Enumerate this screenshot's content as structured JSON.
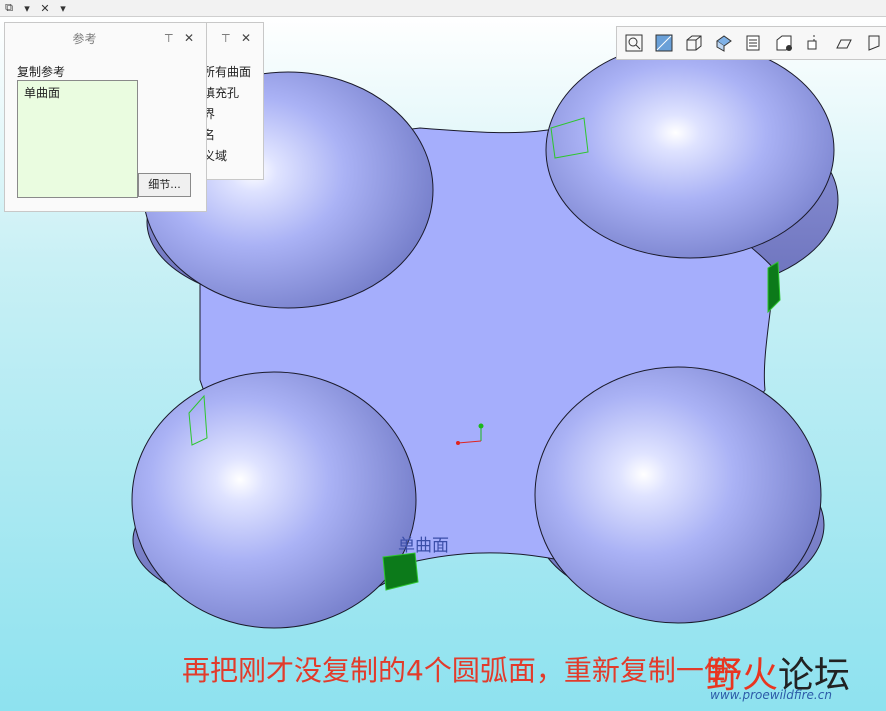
{
  "topbar": {
    "icons": [
      "window-restore-icon",
      "dropdown-arrow-icon",
      "tools-icon",
      "dropdown-arrow-icon"
    ]
  },
  "ref_panel": {
    "title": "参考",
    "section_label": "复制参考",
    "items": [
      "单曲面"
    ],
    "details_button": "细节..."
  },
  "back_panel": {
    "items": [
      "所有曲面",
      "填充孔",
      "界",
      "名",
      "义域"
    ]
  },
  "view_toolbar": {
    "icons": [
      "zoom-fit-icon",
      "zoom-area-icon",
      "display-style-icon",
      "saved-views-icon",
      "layers-icon",
      "camera-icon",
      "spin-center-icon",
      "annotation-icon",
      "plane-display-icon"
    ]
  },
  "model": {
    "surface_label": "单曲面",
    "colors": {
      "body": "#a6aef4",
      "edge": "#1a1a2a",
      "selected": "#0c7a1a",
      "green_line": "#2ec62e"
    }
  },
  "caption": "再把刚才没复制的4个圆弧面，重新复制一份",
  "logo": {
    "name_part1": "野火",
    "name_part2": "论坛",
    "url": "www.proewildfire.cn"
  }
}
